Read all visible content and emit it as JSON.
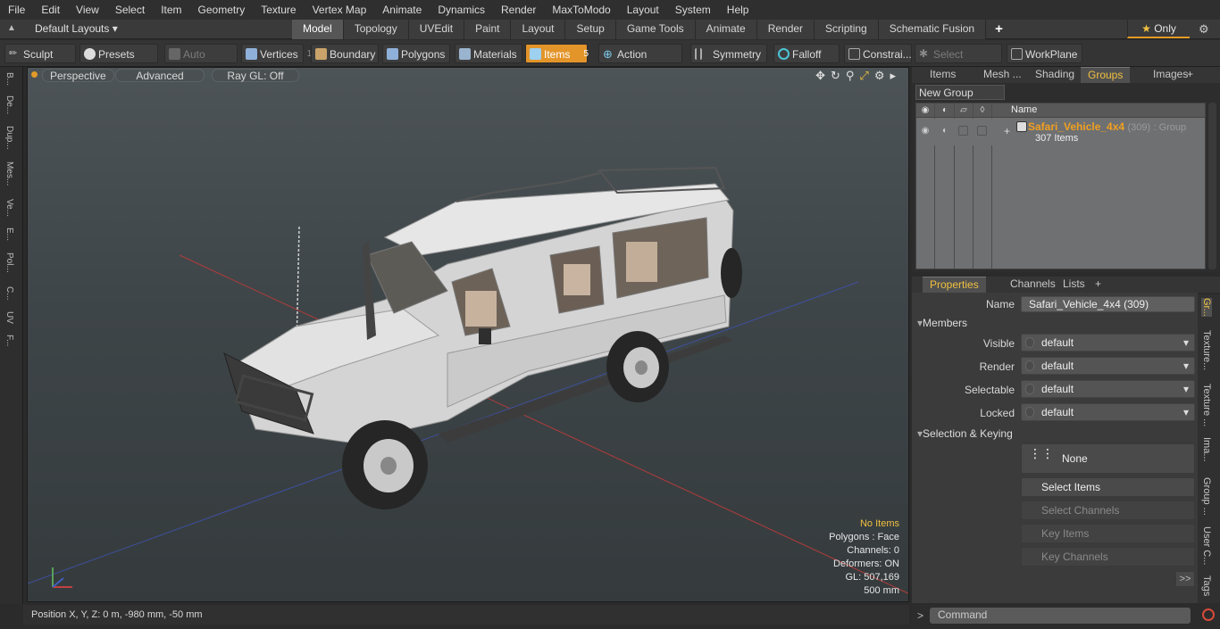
{
  "menu": [
    "File",
    "Edit",
    "View",
    "Select",
    "Item",
    "Geometry",
    "Texture",
    "Vertex Map",
    "Animate",
    "Dynamics",
    "Render",
    "MaxToModo",
    "Layout",
    "System",
    "Help"
  ],
  "layout": {
    "dropdown": "Default Layouts",
    "tabs": [
      "Model",
      "Topology",
      "UVEdit",
      "Paint",
      "Layout",
      "Setup",
      "Game Tools",
      "Animate",
      "Render",
      "Scripting",
      "Schematic Fusion"
    ],
    "active_tab": "Model",
    "only_label": "Only"
  },
  "toolbar": {
    "sculpt": "Sculpt",
    "presets": "Presets",
    "auto_select": "Auto Select",
    "vertices": "Vertices",
    "vertices_count": "1",
    "boundary": "Boundary",
    "polygons": "Polygons",
    "materials": "Materials",
    "items": "Items",
    "items_count": "5",
    "action_center": "Action Center",
    "symmetry": "Symmetry",
    "falloff": "Falloff",
    "constraints": "Constrai...",
    "select_through": "Select Through",
    "workplane": "WorkPlane"
  },
  "left_palette": [
    "B...",
    "De...",
    "Dup...",
    "Mes...",
    "Ve...",
    "E...",
    "Pol...",
    "C...",
    "UV",
    "F..."
  ],
  "viewport": {
    "perspective": "Perspective",
    "advanced": "Advanced",
    "ray_gl": "Ray GL: Off",
    "info": {
      "no_items": "No Items",
      "polygons": "Polygons : Face",
      "channels": "Channels: 0",
      "deformers": "Deformers: ON",
      "gl": "GL: 507,169",
      "scale": "500 mm"
    }
  },
  "status": {
    "position": "Position X, Y, Z:   0 m, -980 mm, -50 mm"
  },
  "right_top": {
    "tabs": [
      "Items",
      "Mesh ...",
      "Shading",
      "Groups",
      "Images"
    ],
    "active_tab": "Groups",
    "new_group": "New Group",
    "col_name": "Name",
    "group_name": "Safari_Vehicle_4x4",
    "group_count": "(309)",
    "group_type": ": Group",
    "group_items": "307 Items"
  },
  "properties": {
    "tabs": [
      "Properties",
      "Channels",
      "Lists"
    ],
    "active_tab": "Properties",
    "name_label": "Name",
    "name_value": "Safari_Vehicle_4x4 (309)",
    "members_section": "Members",
    "visible_label": "Visible",
    "visible_value": "default",
    "render_label": "Render",
    "render_value": "default",
    "selectable_label": "Selectable",
    "selectable_value": "default",
    "locked_label": "Locked",
    "locked_value": "default",
    "selection_section": "Selection & Keying",
    "none_btn": "None",
    "select_items": "Select Items",
    "select_channels": "Select Channels",
    "key_items": "Key Items",
    "key_channels": "Key Channels",
    "more": ">>"
  },
  "right_side_tabs": [
    "Gr...",
    "Texture...",
    "Texture ...",
    "Ima...",
    "Group ...",
    "User C...",
    "Tags"
  ],
  "command": {
    "placeholder": "Command"
  },
  "colors": {
    "accent": "#e3952a",
    "highlight_text": "#f0c040",
    "group_name": "#f0a020"
  }
}
